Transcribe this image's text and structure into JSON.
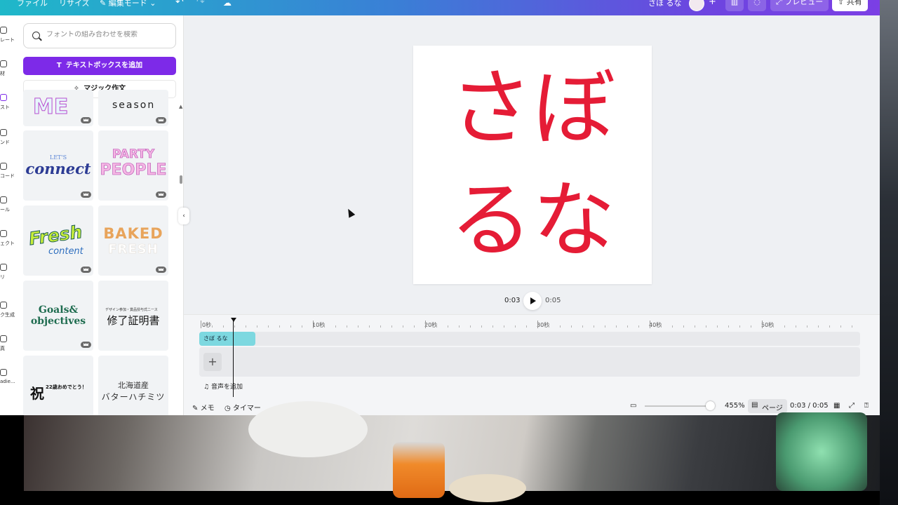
{
  "topbar": {
    "file": "ファイル",
    "resize": "リサイズ",
    "edit_mode": "編集モード",
    "doc_title": "さほ るな",
    "preview": "プレビュー",
    "share": "共有"
  },
  "rail": {
    "items": [
      "レート",
      "材",
      "スト",
      "ンド",
      "コード",
      "ール",
      "ェクト",
      "リ",
      "ク生成",
      "真",
      "adie..."
    ]
  },
  "panel": {
    "search_placeholder": "フォントの組み合わせを検索",
    "add_textbox": "テキストボックスを追加",
    "magic_write": "マジック作文",
    "tiles": [
      {
        "line1": "ME",
        "line2": ""
      },
      {
        "line1": "season",
        "line2": ""
      },
      {
        "line1": "LET'S",
        "line2": "connect"
      },
      {
        "line1": "PARTY",
        "line2": "PEOPLE"
      },
      {
        "line1": "Fresh",
        "line2": "content"
      },
      {
        "line1": "BAKED",
        "line2": "FRESH"
      },
      {
        "line1": "Goals&",
        "line2": "objectives"
      },
      {
        "line1": "デザイン参加・賞品授与式ニース",
        "line2": "修了証明書"
      },
      {
        "line1": "祝",
        "line2": "22歳おめでとう！"
      },
      {
        "line1": "北海道産",
        "line2": "バターハチミツ"
      }
    ]
  },
  "canvas": {
    "line1": "さぼ",
    "line2": "るな"
  },
  "playback": {
    "current": "0:03",
    "total": "0:05"
  },
  "timeline": {
    "ruler": [
      "0秒",
      "10秒",
      "20秒",
      "30秒",
      "40秒",
      "50秒"
    ],
    "clip_label": "さぼ るな",
    "add_page": "+",
    "add_audio": "音声を追加"
  },
  "footer": {
    "memo": "メモ",
    "timer": "タイマー",
    "zoom": "455%",
    "zoom_level": 0.93,
    "page_view": "ページ",
    "page_time": "0:03 / 0:05"
  },
  "colors": {
    "accent": "#7d2ae8",
    "canvas_text": "#e51c36",
    "clip": "#7dd8e0"
  }
}
